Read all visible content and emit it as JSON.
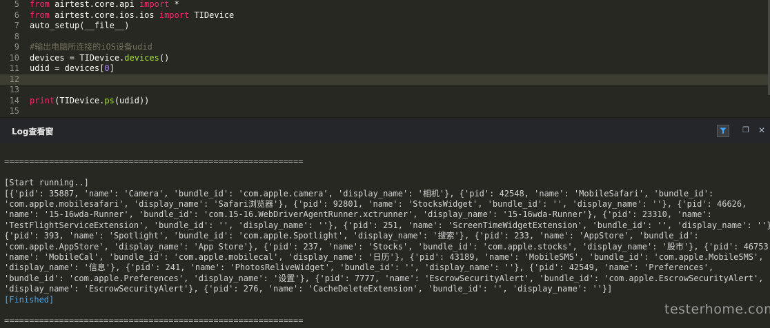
{
  "editor": {
    "lines": [
      {
        "num": "5",
        "tokens": [
          {
            "t": "from",
            "c": "kw"
          },
          {
            "t": " airtest.core.api ",
            "c": ""
          },
          {
            "t": "import",
            "c": "kw"
          },
          {
            "t": " *",
            "c": ""
          }
        ]
      },
      {
        "num": "6",
        "tokens": [
          {
            "t": "from",
            "c": "kw"
          },
          {
            "t": " airtest.core.ios.ios ",
            "c": ""
          },
          {
            "t": "import",
            "c": "kw"
          },
          {
            "t": " TIDevice",
            "c": ""
          }
        ]
      },
      {
        "num": "7",
        "tokens": [
          {
            "t": "auto_setup(__file__)",
            "c": ""
          }
        ]
      },
      {
        "num": "8",
        "tokens": []
      },
      {
        "num": "9",
        "tokens": [
          {
            "t": "#输出电脑所连接的iOS设备udid",
            "c": "cm"
          }
        ]
      },
      {
        "num": "10",
        "tokens": [
          {
            "t": "devices = TIDevice.",
            "c": ""
          },
          {
            "t": "devices",
            "c": "fn"
          },
          {
            "t": "()",
            "c": ""
          }
        ]
      },
      {
        "num": "11",
        "tokens": [
          {
            "t": "udid = devices[",
            "c": ""
          },
          {
            "t": "0",
            "c": "num"
          },
          {
            "t": "]",
            "c": ""
          }
        ]
      },
      {
        "num": "12",
        "tokens": [],
        "current": true
      },
      {
        "num": "13",
        "tokens": []
      },
      {
        "num": "14",
        "tokens": [
          {
            "t": "print",
            "c": "kw"
          },
          {
            "t": "(TIDevice.",
            "c": ""
          },
          {
            "t": "ps",
            "c": "fn"
          },
          {
            "t": "(udid))",
            "c": ""
          }
        ]
      },
      {
        "num": "15",
        "tokens": []
      }
    ]
  },
  "log_panel": {
    "title": "Log查看窗",
    "filter_icon": "filter-icon",
    "maximize_icon": "maximize-icon",
    "close_icon": "close-icon",
    "maximize_glyph": "❐",
    "close_glyph": "✕",
    "lines": [
      {
        "text": "",
        "kind": "sep"
      },
      {
        "text": "============================================================",
        "kind": "sep"
      },
      {
        "text": "",
        "kind": ""
      },
      {
        "text": "[Start running..]",
        "kind": ""
      },
      {
        "text": "[{'pid': 35887, 'name': 'Camera', 'bundle_id': 'com.apple.camera', 'display_name': '相机'}, {'pid': 42548, 'name': 'MobileSafari', 'bundle_id':",
        "kind": ""
      },
      {
        "text": "'com.apple.mobilesafari', 'display_name': 'Safari浏览器'}, {'pid': 92801, 'name': 'StocksWidget', 'bundle_id': '', 'display_name': ''}, {'pid': 46626,",
        "kind": ""
      },
      {
        "text": "'name': '15-16wda-Runner', 'bundle_id': 'com.15-16.WebDriverAgentRunner.xctrunner', 'display_name': '15-16wda-Runner'}, {'pid': 23310, 'name':",
        "kind": ""
      },
      {
        "text": "'TestFlightServiceExtension', 'bundle_id': '', 'display_name': ''}, {'pid': 251, 'name': 'ScreenTimeWidgetExtension', 'bundle_id': '', 'display_name': ''},",
        "kind": ""
      },
      {
        "text": "{'pid': 393, 'name': 'Spotlight', 'bundle_id': 'com.apple.Spotlight', 'display_name': '搜索'}, {'pid': 233, 'name': 'AppStore', 'bundle_id':",
        "kind": ""
      },
      {
        "text": "'com.apple.AppStore', 'display_name': 'App Store'}, {'pid': 237, 'name': 'Stocks', 'bundle_id': 'com.apple.stocks', 'display_name': '股市'}, {'pid': 46753,",
        "kind": ""
      },
      {
        "text": "'name': 'MobileCal', 'bundle_id': 'com.apple.mobilecal', 'display_name': '日历'}, {'pid': 43189, 'name': 'MobileSMS', 'bundle_id': 'com.apple.MobileSMS',",
        "kind": ""
      },
      {
        "text": "'display_name': '信息'}, {'pid': 241, 'name': 'PhotosReliveWidget', 'bundle_id': '', 'display_name': ''}, {'pid': 42549, 'name': 'Preferences',",
        "kind": ""
      },
      {
        "text": "'bundle_id': 'com.apple.Preferences', 'display_name': '设置'}, {'pid': 7777, 'name': 'EscrowSecurityAlert', 'bundle_id': 'com.apple.EscrowSecurityAlert',",
        "kind": ""
      },
      {
        "text": "'display_name': 'EscrowSecurityAlert'}, {'pid': 276, 'name': 'CacheDeleteExtension', 'bundle_id': '', 'display_name': ''}]",
        "kind": ""
      },
      {
        "text": "[Finished]",
        "kind": "finished"
      },
      {
        "text": "",
        "kind": ""
      },
      {
        "text": "============================================================",
        "kind": "sep"
      }
    ]
  },
  "watermark": "testerhome.com",
  "colors": {
    "background": "#272822",
    "keyword": "#f92672",
    "function": "#a6e22e",
    "number": "#ae81ff",
    "comment": "#75715e",
    "finished": "#4ea6e6"
  }
}
